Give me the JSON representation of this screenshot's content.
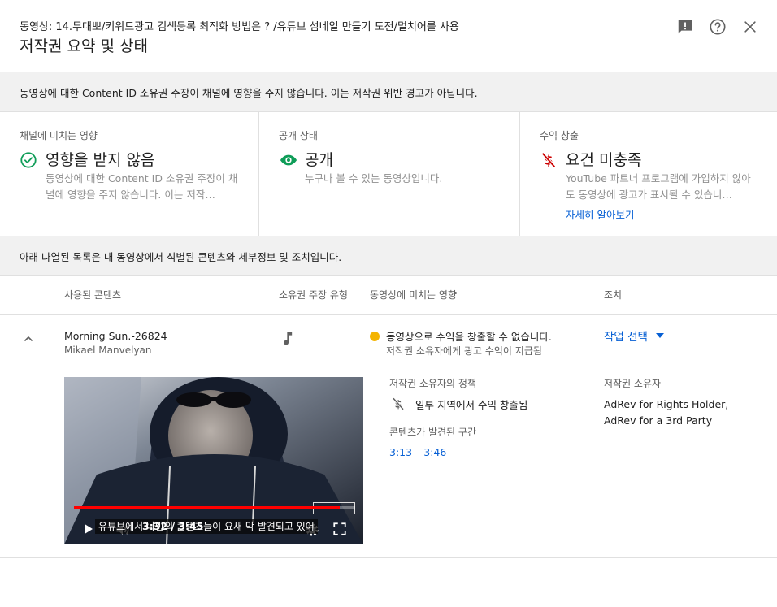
{
  "header": {
    "video_label": "동영상: 14.무대뽀/키워드광고 검색등록 최적화 방법은 ? /유튜브 섬네일 만들기 도전/멀치어를 사용",
    "title": "저작권 요약 및 상태",
    "icons": [
      "feedback-icon",
      "help-icon",
      "close-icon"
    ]
  },
  "banner": {
    "text": "동영상에 대한 Content ID 소유권 주장이 채널에 영향을 주지 않습니다. 이는 저작권 위반 경고가 아닙니다."
  },
  "cards": [
    {
      "label": "채널에 미치는 영향",
      "status": "영향을 받지 않음",
      "icon": "check-circle-icon",
      "color": "#0f9d58",
      "description": "동영상에 대한 Content ID 소유권 주장이 채널에 영향을 주지 않습니다. 이는 저작…"
    },
    {
      "label": "공개 상태",
      "status": "공개",
      "icon": "eye-icon",
      "color": "#0f9d58",
      "description": "누구나 볼 수 있는 동영상입니다."
    },
    {
      "label": "수익 창출",
      "status": "요건 미충족",
      "icon": "no-dollar-icon",
      "color": "#cc0000",
      "description": "YouTube 파트너 프로그램에 가입하지 않아도 동영상에 광고가 표시될 수 있습니…",
      "link": "자세히 알아보기"
    }
  ],
  "list_banner": {
    "text": "아래 나열된 목록은 내 동영상에서 식별된 콘텐츠와 세부정보 및 조치입니다."
  },
  "table": {
    "headers": [
      "사용된 콘텐츠",
      "소유권 주장 유형",
      "동영상에 미치는 영향",
      "조치"
    ],
    "row": {
      "title": "Morning Sun.-26824",
      "artist": "Mikael Manvelyan",
      "claim_type_icon": "music-note-icon",
      "impact_status_color": "#f4b400",
      "impact_main": "동영상으로 수익을 창출할 수 없습니다.",
      "impact_sub": "저작권 소유자에게 광고 수익이 지급됨",
      "action_label": "작업 선택",
      "policy_label": "저작권 소유자의 정책",
      "policy_icon": "no-dollar-icon",
      "policy_text": "일부 지역에서 수익 창출됨",
      "segment_label": "콘텐츠가 발견된 구간",
      "segment": "3:13 – 3:46",
      "owner_label": "저작권 소유자",
      "owner": "AdRev for Rights Holder, AdRev for a 3rd Party",
      "player": {
        "current_time": "3:32",
        "duration": "3:45",
        "time_display": "3:32 / 3:45",
        "progress": 0.944,
        "caption": "유튜브에서 나만의 콘텐츠들이 요새 막 발견되고 있어"
      }
    }
  }
}
